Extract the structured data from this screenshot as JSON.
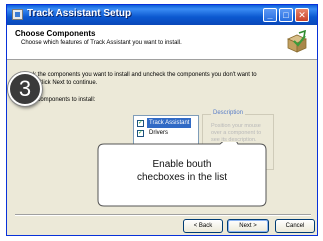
{
  "window": {
    "title": "Track Assistant Setup",
    "buttons": {
      "minimize": "_",
      "maximize": "□",
      "close": "✕"
    },
    "colors": {
      "titlebar": "#0a5ed8",
      "close": "#c8432a",
      "face": "#ece9d8"
    }
  },
  "header": {
    "title": "Choose Components",
    "subtitle": "Choose which features of Track Assistant you want to install.",
    "icon": "install-box-icon"
  },
  "body": {
    "instructions_line1": "Check the components you want to install and uncheck the components you don't want to",
    "instructions_line2": "install. Click Next to continue.",
    "select_label": "Select components to install:"
  },
  "components": {
    "items": [
      {
        "label": "Track Assistant",
        "checked": true,
        "selected": true
      },
      {
        "label": "Drivers",
        "checked": true,
        "selected": false
      }
    ]
  },
  "description": {
    "title": "Description",
    "text": "Position your mouse over a component to see its description."
  },
  "footer": {
    "back_label": "< Back",
    "next_label": "Next >",
    "cancel_label": "Cancel"
  },
  "overlay": {
    "step_number": "3",
    "callout_line1": "Enable bouth",
    "callout_line2": "checboxes in the list"
  }
}
